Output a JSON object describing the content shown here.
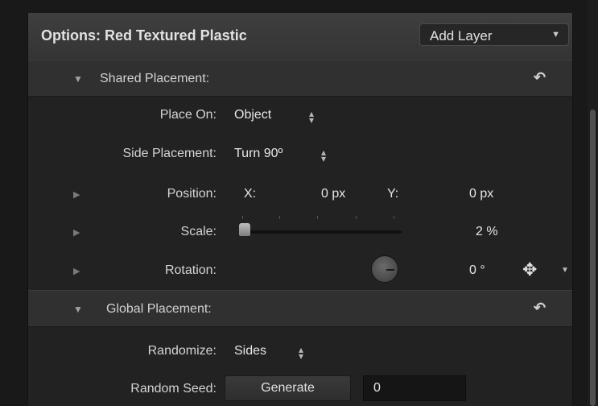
{
  "header": {
    "title": "Options: Red Textured Plastic",
    "add_layer_label": "Add Layer",
    "dropdown_arrow": "▼"
  },
  "shared_placement": {
    "title": "Shared Placement:",
    "reset_icon": "undo-arrow",
    "place_on": {
      "label": "Place On:",
      "value": "Object"
    },
    "side_placement": {
      "label": "Side Placement:",
      "value": "Turn 90º"
    },
    "position": {
      "label": "Position:",
      "x_label": "X:",
      "x_value": "0 px",
      "y_label": "Y:",
      "y_value": "0 px"
    },
    "scale": {
      "label": "Scale:",
      "value": "2 %",
      "slider_fraction": 0.02
    },
    "rotation": {
      "label": "Rotation:",
      "value": "0 °"
    }
  },
  "global_placement": {
    "title": "Global Placement:",
    "randomize": {
      "label": "Randomize:",
      "value": "Sides"
    },
    "random_seed": {
      "label": "Random Seed:",
      "button_label": "Generate",
      "value": "0"
    }
  },
  "colors": {
    "panel_bg": "#222222",
    "header_bg": "#303030",
    "text": "#d6d6d6"
  }
}
